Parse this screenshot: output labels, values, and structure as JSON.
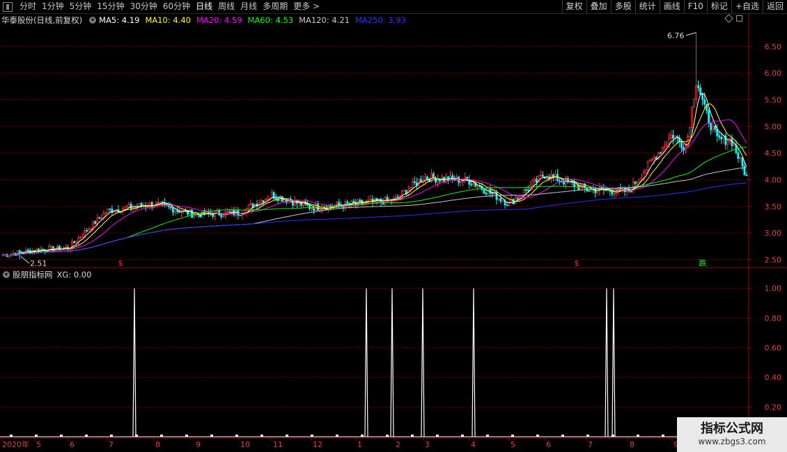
{
  "toolbar": {
    "tabs": [
      "分时",
      "1分钟",
      "5分钟",
      "15分钟",
      "30分钟",
      "60分钟",
      "日线",
      "周线",
      "月线",
      "多周期",
      "更多 >"
    ],
    "active_tab": "日线",
    "right_buttons": [
      "复权",
      "叠加",
      "多股",
      "统计",
      "画线",
      "F10",
      "标记",
      "+自选",
      "返回"
    ]
  },
  "main_legend": {
    "title": "华泰股份(日线,前复权)",
    "ma": [
      {
        "label": "MA5: 4.19",
        "color": "#ffffff"
      },
      {
        "label": "MA10: 4.40",
        "color": "#ffff00"
      },
      {
        "label": "MA20: 4.59",
        "color": "#ff00ff"
      },
      {
        "label": "MA60: 4.53",
        "color": "#00ff00"
      },
      {
        "label": "MA120: 4.21",
        "color": "#c8c8c8"
      },
      {
        "label": "MA250: 3.93",
        "color": "#3030ff"
      }
    ]
  },
  "indicator_legend": {
    "name": "股朋指标网",
    "value_label": "XG: 0.00"
  },
  "annotations": {
    "high": "6.76",
    "low": "2.51",
    "markers": [
      "$",
      "$",
      "跌"
    ]
  },
  "watermark": {
    "line1": "指标公式网",
    "line2": "www.zbgs3.com"
  },
  "colors": {
    "up": "#ff3232",
    "down": "#00ffff",
    "grid": "#8b0000",
    "axis": "#a00000"
  },
  "chart_data": [
    {
      "type": "candlestick",
      "title": "华泰股份(日线,前复权)",
      "price_axis_ticks": [
        2.5,
        3.0,
        3.5,
        4.0,
        4.5,
        5.0,
        5.5,
        6.0,
        6.5
      ],
      "price_axis_labels": [
        "2.50",
        "3.00",
        "3.50",
        "4.00",
        "4.50",
        "5.00",
        "5.50",
        "6.00",
        "6.50"
      ],
      "ylim": [
        2.35,
        6.85
      ],
      "x_month_labels": [
        "2020年",
        "5",
        "6",
        "7",
        "8",
        "9",
        "10",
        "11",
        "12",
        "1",
        "2",
        "3",
        "4",
        "5",
        "6",
        "7",
        "8",
        "9"
      ],
      "close_by_month": [
        2.58,
        2.68,
        2.72,
        3.42,
        3.55,
        3.35,
        3.38,
        3.72,
        3.48,
        3.55,
        3.62,
        4.05,
        3.98,
        3.55,
        4.1,
        3.82,
        3.78,
        4.85
      ],
      "max_high": 6.76,
      "min_low": 2.51,
      "series": [
        {
          "name": "MA5",
          "last": 4.19
        },
        {
          "name": "MA10",
          "last": 4.4
        },
        {
          "name": "MA20",
          "last": 4.59
        },
        {
          "name": "MA60",
          "last": 4.53
        },
        {
          "name": "MA120",
          "last": 4.21
        },
        {
          "name": "MA250",
          "last": 3.93
        }
      ]
    },
    {
      "type": "bar",
      "series": [
        {
          "name": "XG",
          "values_last": 0.0
        }
      ],
      "y_axis_labels": [
        "0.20",
        "0.40",
        "0.60",
        "0.80",
        "1.00"
      ],
      "ylim": [
        0,
        1.05
      ],
      "signal_months": [
        "7",
        "12",
        "1",
        "2",
        "3",
        "6",
        "7"
      ],
      "signal_values": [
        1,
        1,
        1,
        1,
        1,
        1,
        1
      ]
    }
  ]
}
